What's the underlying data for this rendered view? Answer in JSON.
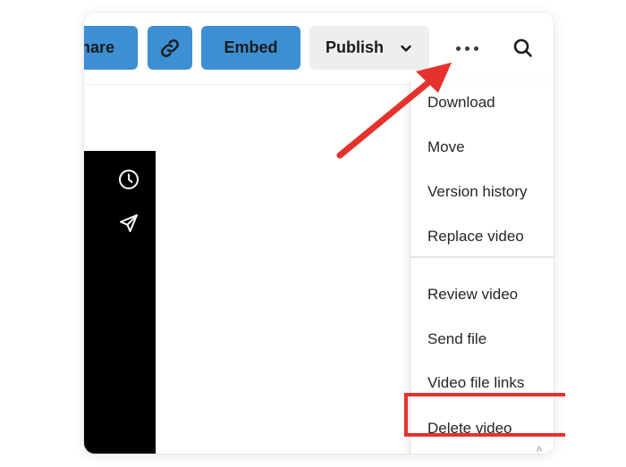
{
  "toolbar": {
    "share_label": "hare",
    "embed_label": "Embed",
    "publish_label": "Publish"
  },
  "icons": {
    "link": "link-icon",
    "chevron": "chevron-down-icon",
    "more": "more-horizontal-icon",
    "search": "search-icon",
    "history": "clock-icon",
    "send": "send-icon"
  },
  "menu": {
    "items": [
      {
        "label": "Download"
      },
      {
        "label": "Move"
      },
      {
        "label": "Version history"
      },
      {
        "label": "Replace video"
      },
      {
        "label": "Review video"
      },
      {
        "label": "Send file"
      },
      {
        "label": "Video file links"
      },
      {
        "label": "Delete video"
      }
    ]
  },
  "edge_text": "A",
  "colors": {
    "accent_blue": "#3d8fd4",
    "annotation_red": "#e5322d",
    "publish_bg": "#eeeeee",
    "video_bg": "#000000"
  }
}
